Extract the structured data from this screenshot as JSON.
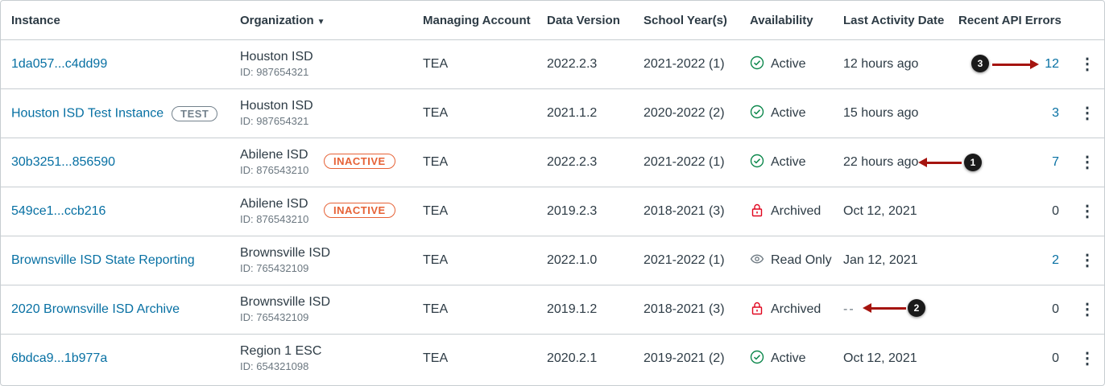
{
  "columns": {
    "instance": "Instance",
    "organization": "Organization",
    "sort_indicator": "▼",
    "managing_account": "Managing Account",
    "data_version": "Data Version",
    "school_years": "School Year(s)",
    "availability": "Availability",
    "last_activity": "Last Activity Date",
    "api_errors": "Recent API Errors"
  },
  "rows": [
    {
      "instance": "1da057...c4dd99",
      "test_badge": "",
      "org_name": "Houston ISD",
      "org_id": "ID: 987654321",
      "inactive_badge": "",
      "managing": "TEA",
      "version": "2022.2.3",
      "years": "2021-2022 (1)",
      "availability": "Active",
      "availability_icon": "check-circle-icon",
      "last_activity": "12 hours ago",
      "errors": "12",
      "errors_link": true
    },
    {
      "instance": "Houston ISD Test Instance",
      "test_badge": "TEST",
      "org_name": "Houston ISD",
      "org_id": "ID: 987654321",
      "inactive_badge": "",
      "managing": "TEA",
      "version": "2021.1.2",
      "years": "2020-2022 (2)",
      "availability": "Active",
      "availability_icon": "check-circle-icon",
      "last_activity": "15 hours ago",
      "errors": "3",
      "errors_link": true
    },
    {
      "instance": "30b3251...856590",
      "test_badge": "",
      "org_name": "Abilene ISD",
      "org_id": "ID: 876543210",
      "inactive_badge": "INACTIVE",
      "managing": "TEA",
      "version": "2022.2.3",
      "years": "2021-2022 (1)",
      "availability": "Active",
      "availability_icon": "check-circle-icon",
      "last_activity": "22 hours ago",
      "errors": "7",
      "errors_link": true
    },
    {
      "instance": "549ce1...ccb216",
      "test_badge": "",
      "org_name": "Abilene ISD",
      "org_id": "ID: 876543210",
      "inactive_badge": "INACTIVE",
      "managing": "TEA",
      "version": "2019.2.3",
      "years": "2018-2021 (3)",
      "availability": "Archived",
      "availability_icon": "lock-icon",
      "last_activity": "Oct 12, 2021",
      "errors": "0",
      "errors_link": false
    },
    {
      "instance": "Brownsville ISD State Reporting",
      "test_badge": "",
      "org_name": "Brownsville ISD",
      "org_id": "ID: 765432109",
      "inactive_badge": "",
      "managing": "TEA",
      "version": "2022.1.0",
      "years": "2021-2022 (1)",
      "availability": "Read Only",
      "availability_icon": "eye-icon",
      "last_activity": "Jan 12, 2021",
      "errors": "2",
      "errors_link": true
    },
    {
      "instance": "2020 Brownsville ISD Archive",
      "test_badge": "",
      "org_name": "Brownsville ISD",
      "org_id": "ID: 765432109",
      "inactive_badge": "",
      "managing": "TEA",
      "version": "2019.1.2",
      "years": "2018-2021 (3)",
      "availability": "Archived",
      "availability_icon": "lock-icon",
      "last_activity": "--",
      "errors": "0",
      "errors_link": false
    },
    {
      "instance": "6bdca9...1b977a",
      "test_badge": "",
      "org_name": "Region 1 ESC",
      "org_id": "ID: 654321098",
      "inactive_badge": "",
      "managing": "TEA",
      "version": "2020.2.1",
      "years": "2019-2021 (2)",
      "availability": "Active",
      "availability_icon": "check-circle-icon",
      "last_activity": "Oct 12, 2021",
      "errors": "0",
      "errors_link": false
    }
  ],
  "kebab_glyph": "⋮",
  "callouts": [
    "1",
    "2",
    "3"
  ],
  "colors": {
    "link": "#0770a3",
    "inactive": "#e66135",
    "active_icon": "#0b874b",
    "archived_icon": "#e0061f",
    "arrow": "#a5140f"
  }
}
